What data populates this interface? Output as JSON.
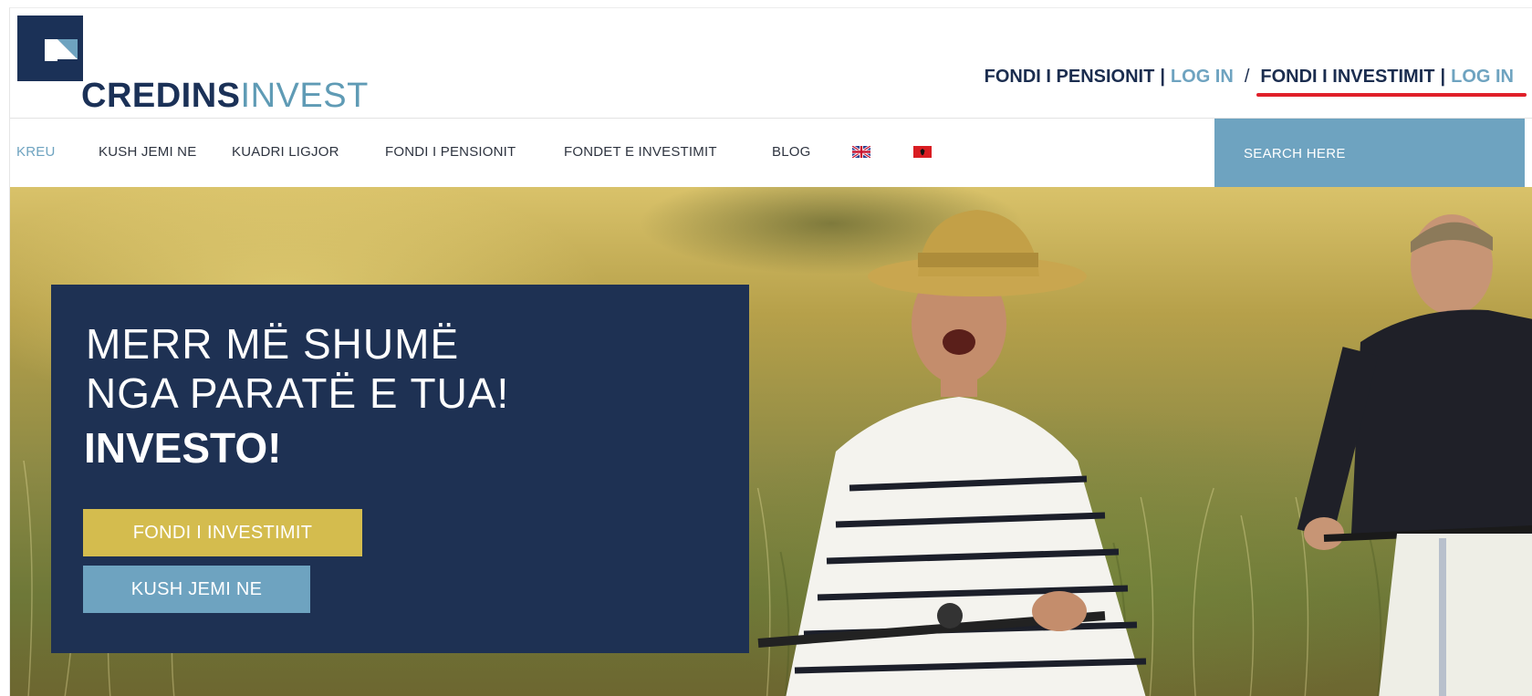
{
  "logo": {
    "text_strong": "CREDINS",
    "text_light": "INVEST"
  },
  "toplinks": {
    "pension_fund": "FONDI I PENSIONIT",
    "separator": "|",
    "pension_login": "LOG IN",
    "slash": "/",
    "investment_fund": "FONDI I INVESTIMIT",
    "investment_login": "LOG IN"
  },
  "nav": {
    "items": [
      {
        "label": "KREU",
        "active": true
      },
      {
        "label": "KUSH JEMI NE"
      },
      {
        "label": "KUADRI LIGJOR"
      },
      {
        "label": "FONDI I PENSIONIT"
      },
      {
        "label": "FONDET E INVESTIMIT"
      },
      {
        "label": "BLOG"
      }
    ],
    "flags": [
      {
        "icon": "uk-flag-icon"
      },
      {
        "icon": "albania-flag-icon"
      }
    ],
    "search_placeholder": "SEARCH HERE"
  },
  "hero": {
    "line1": "MERR MË SHUMË",
    "line2": "NGA PARATË E TUA!",
    "line3": "INVESTO!",
    "primary_button": "FONDI I INVESTIMIT",
    "secondary_button": "KUSH JEMI NE"
  },
  "colors": {
    "navy": "#1e3153",
    "accent_blue": "#6ea3c0",
    "gold": "#d4bc4e",
    "highlight_red": "#e0202a"
  }
}
